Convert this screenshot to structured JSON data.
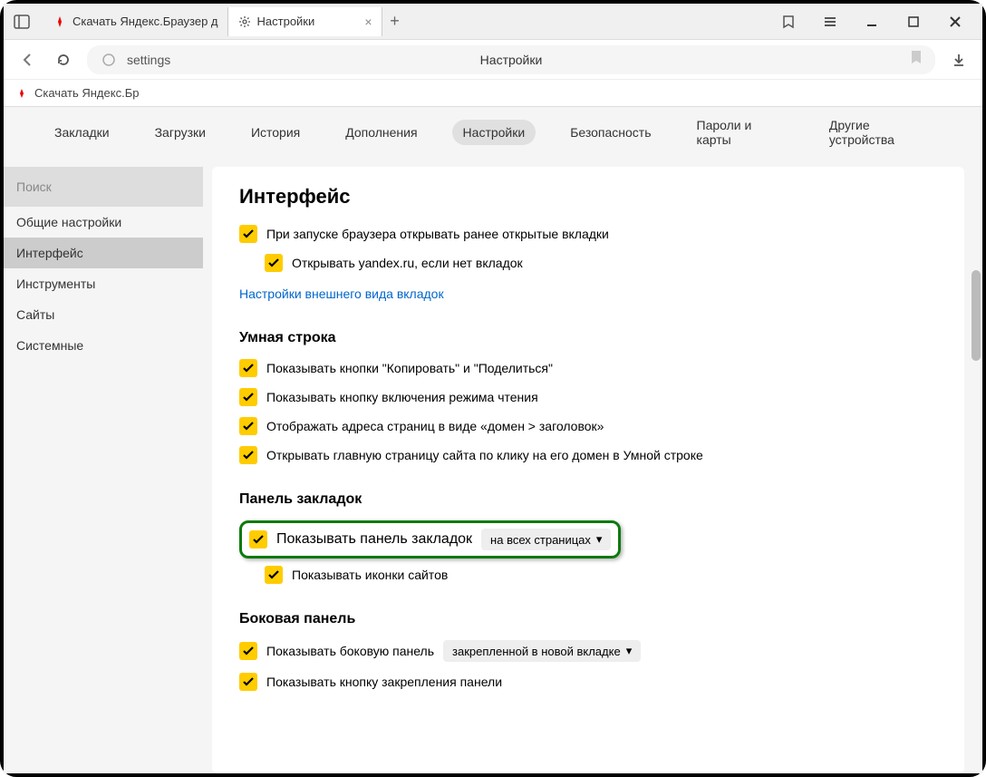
{
  "titlebar": {
    "tab1": {
      "label": "Скачать Яндекс.Браузер д"
    },
    "tab2": {
      "label": "Настройки"
    }
  },
  "addressbar": {
    "url": "settings",
    "page_title": "Настройки"
  },
  "bookmarks": {
    "item1": "Скачать Яндекс.Бр"
  },
  "topnav": {
    "bookmarks": "Закладки",
    "downloads": "Загрузки",
    "history": "История",
    "addons": "Дополнения",
    "settings": "Настройки",
    "security": "Безопасность",
    "passwords": "Пароли и карты",
    "devices": "Другие устройства"
  },
  "sidebar": {
    "search_placeholder": "Поиск",
    "general": "Общие настройки",
    "interface": "Интерфейс",
    "tools": "Инструменты",
    "sites": "Сайты",
    "system": "Системные"
  },
  "settings": {
    "interface_title": "Интерфейс",
    "restore_tabs": "При запуске браузера открывать ранее открытые вкладки",
    "open_yandex": "Открывать yandex.ru, если нет вкладок",
    "tab_appearance_link": "Настройки внешнего вида вкладок",
    "smart_line_title": "Умная строка",
    "show_copy_share": "Показывать кнопки \"Копировать\" и \"Поделиться\"",
    "show_reader": "Показывать кнопку включения режима чтения",
    "show_domain_title": "Отображать адреса страниц в виде «домен > заголовок»",
    "open_homepage": "Открывать главную страницу сайта по клику на его домен в Умной строке",
    "bookmarks_panel_title": "Панель закладок",
    "show_bookmarks_panel": "Показывать панель закладок",
    "bookmarks_panel_mode": "на всех страницах",
    "show_site_icons": "Показывать иконки сайтов",
    "side_panel_title": "Боковая панель",
    "show_side_panel": "Показывать боковую панель",
    "side_panel_mode": "закрепленной в новой вкладке",
    "show_pin_btn": "Показывать кнопку закрепления панели"
  }
}
